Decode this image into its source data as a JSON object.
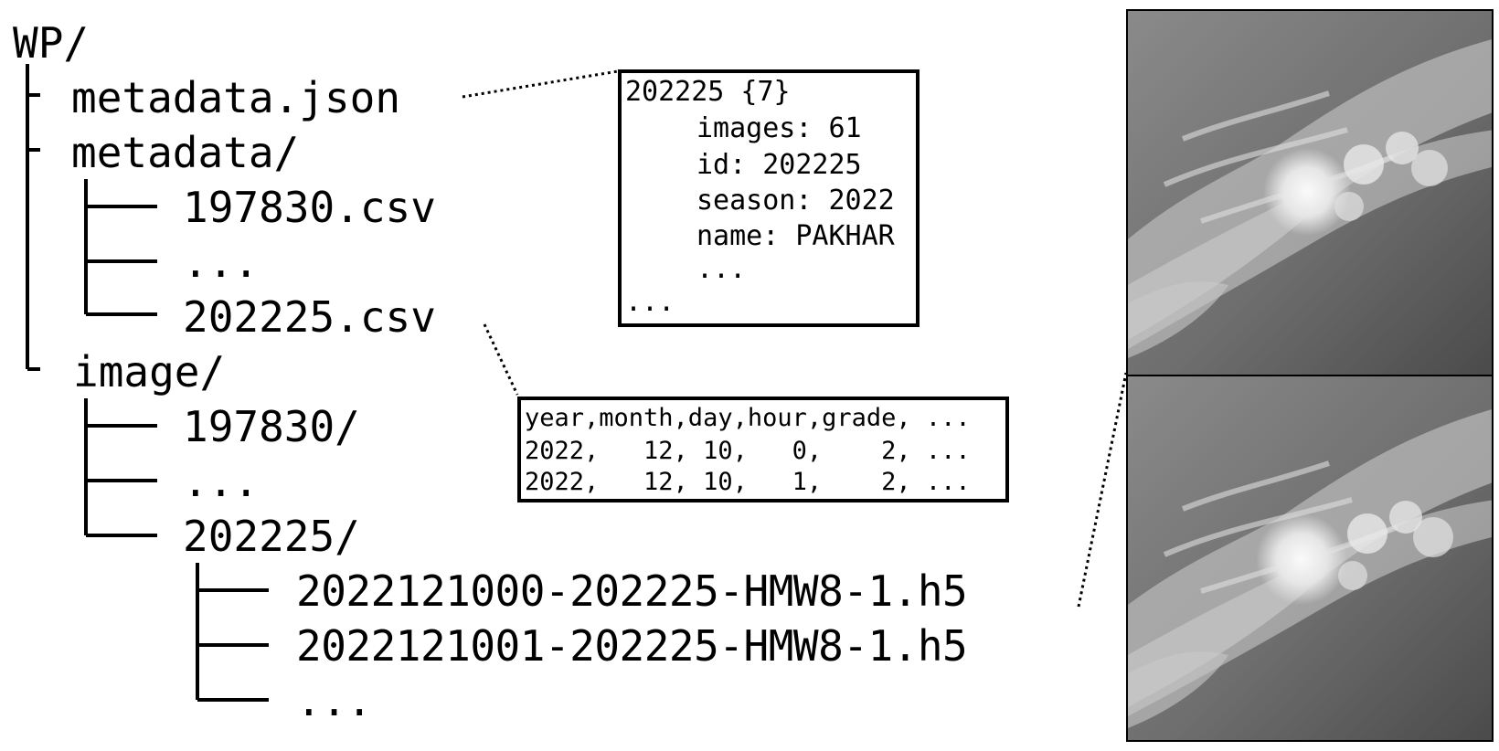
{
  "tree": {
    "root": "WP/",
    "metadata_json": "metadata.json",
    "metadata_dir": "metadata/",
    "metadata_file_first": "197830.csv",
    "metadata_ellipsis": "...",
    "metadata_file_last": "202225.csv",
    "image_dir": "image/",
    "image_sub_first": "197830/",
    "image_ellipsis": "...",
    "image_sub_last": "202225/",
    "h5_file_1": "2022121000-202225-HMW8-1.h5",
    "h5_file_2": "2022121001-202225-HMW8-1.h5",
    "h5_ellipsis": "..."
  },
  "json_preview": {
    "header": "202225 {7}",
    "fields": [
      "images: 61",
      "id: 202225",
      "season: 2022",
      "name: PAKHAR",
      "..."
    ],
    "footer": "..."
  },
  "csv_preview": {
    "rows": [
      "year,month,day,hour,grade, ...",
      "2022,   12, 10,   0,    2, ...",
      "2022,   12, 10,   1,    2, ..."
    ]
  },
  "images": [
    {
      "icon": "satellite-typhoon-image"
    },
    {
      "icon": "satellite-typhoon-image"
    }
  ]
}
